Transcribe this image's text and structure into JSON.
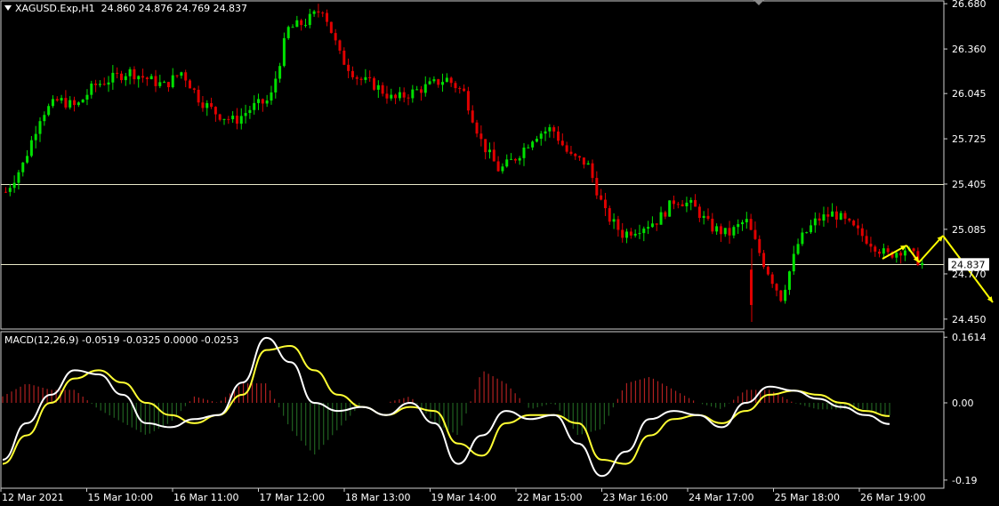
{
  "main_header": {
    "symbol": "XAGUSD.Exp,H1",
    "ohlc": "24.860 24.876 24.769 24.837"
  },
  "macd_header": {
    "text": "MACD(12,26,9) -0.0519 -0.0325 0.0000 -0.0253"
  },
  "price_axis": {
    "ticks": [
      "26.680",
      "26.360",
      "26.045",
      "25.725",
      "25.405",
      "25.085",
      "24.770",
      "24.450"
    ],
    "current_price": "24.837"
  },
  "macd_axis": {
    "ticks": [
      "0.1614",
      "0.00",
      "-0.19"
    ]
  },
  "time_axis": {
    "labels": [
      "12 Mar 2021",
      "15 Mar 10:00",
      "16 Mar 11:00",
      "17 Mar 12:00",
      "18 Mar 13:00",
      "19 Mar 14:00",
      "22 Mar 15:00",
      "23 Mar 16:00",
      "24 Mar 17:00",
      "25 Mar 18:00",
      "26 Mar 19:00"
    ]
  },
  "colors": {
    "background": "#000000",
    "bull_candle": "#00e000",
    "bear_candle": "#e00000",
    "macd_line": "#ffffff",
    "signal_line": "#ffff33",
    "hist_pos": "#b02020",
    "hist_neg": "#206020",
    "support_line": "#e8e8c8",
    "forecast_arrow": "#ffff00"
  },
  "chart_data": {
    "type": "candlestick",
    "series": [
      {
        "name": "XAGUSD.Exp,H1",
        "close": [
          25.35,
          25.55,
          25.9,
          26.0,
          25.95,
          26.1,
          26.15,
          26.2,
          26.15,
          26.1,
          26.2,
          26.0,
          25.9,
          25.85,
          25.95,
          26.0,
          26.5,
          26.55,
          26.65,
          26.3,
          26.15,
          26.1,
          26.0,
          26.05,
          26.1,
          26.15,
          26.05,
          25.7,
          25.5,
          25.6,
          25.75,
          25.8,
          25.6,
          25.55,
          25.2,
          25.05,
          25.1,
          25.15,
          25.3,
          25.25,
          25.1,
          25.05,
          25.15,
          24.85,
          24.6,
          25.0,
          25.15,
          25.2,
          25.1,
          25.0,
          24.9,
          24.95,
          24.84
        ]
      },
      {
        "name": "MACD(12,26,9)",
        "values": [
          -0.14,
          -0.05,
          0.02,
          0.08,
          0.07,
          0.02,
          -0.05,
          -0.06,
          -0.04,
          -0.03,
          0.05,
          0.16,
          0.1,
          0.0,
          -0.02,
          -0.01,
          -0.03,
          0.0,
          -0.05,
          -0.15,
          -0.08,
          -0.02,
          -0.04,
          -0.03,
          -0.1,
          -0.18,
          -0.12,
          -0.04,
          -0.02,
          -0.03,
          -0.06,
          0.0,
          0.04,
          0.03,
          0.01,
          -0.01,
          -0.03,
          -0.052
        ]
      },
      {
        "name": "Signal",
        "values": [
          -0.15,
          -0.08,
          0.0,
          0.06,
          0.08,
          0.05,
          0.0,
          -0.03,
          -0.05,
          -0.03,
          0.02,
          0.13,
          0.14,
          0.08,
          0.02,
          -0.01,
          -0.03,
          -0.01,
          -0.02,
          -0.1,
          -0.13,
          -0.05,
          -0.03,
          -0.03,
          -0.05,
          -0.14,
          -0.15,
          -0.08,
          -0.04,
          -0.03,
          -0.05,
          -0.02,
          0.02,
          0.03,
          0.02,
          0.0,
          -0.02,
          -0.0325
        ]
      }
    ],
    "levels": [
      25.405,
      24.837
    ],
    "ylim": [
      24.38,
      26.7
    ],
    "macd_ylim": [
      -0.21,
      0.175
    ]
  }
}
